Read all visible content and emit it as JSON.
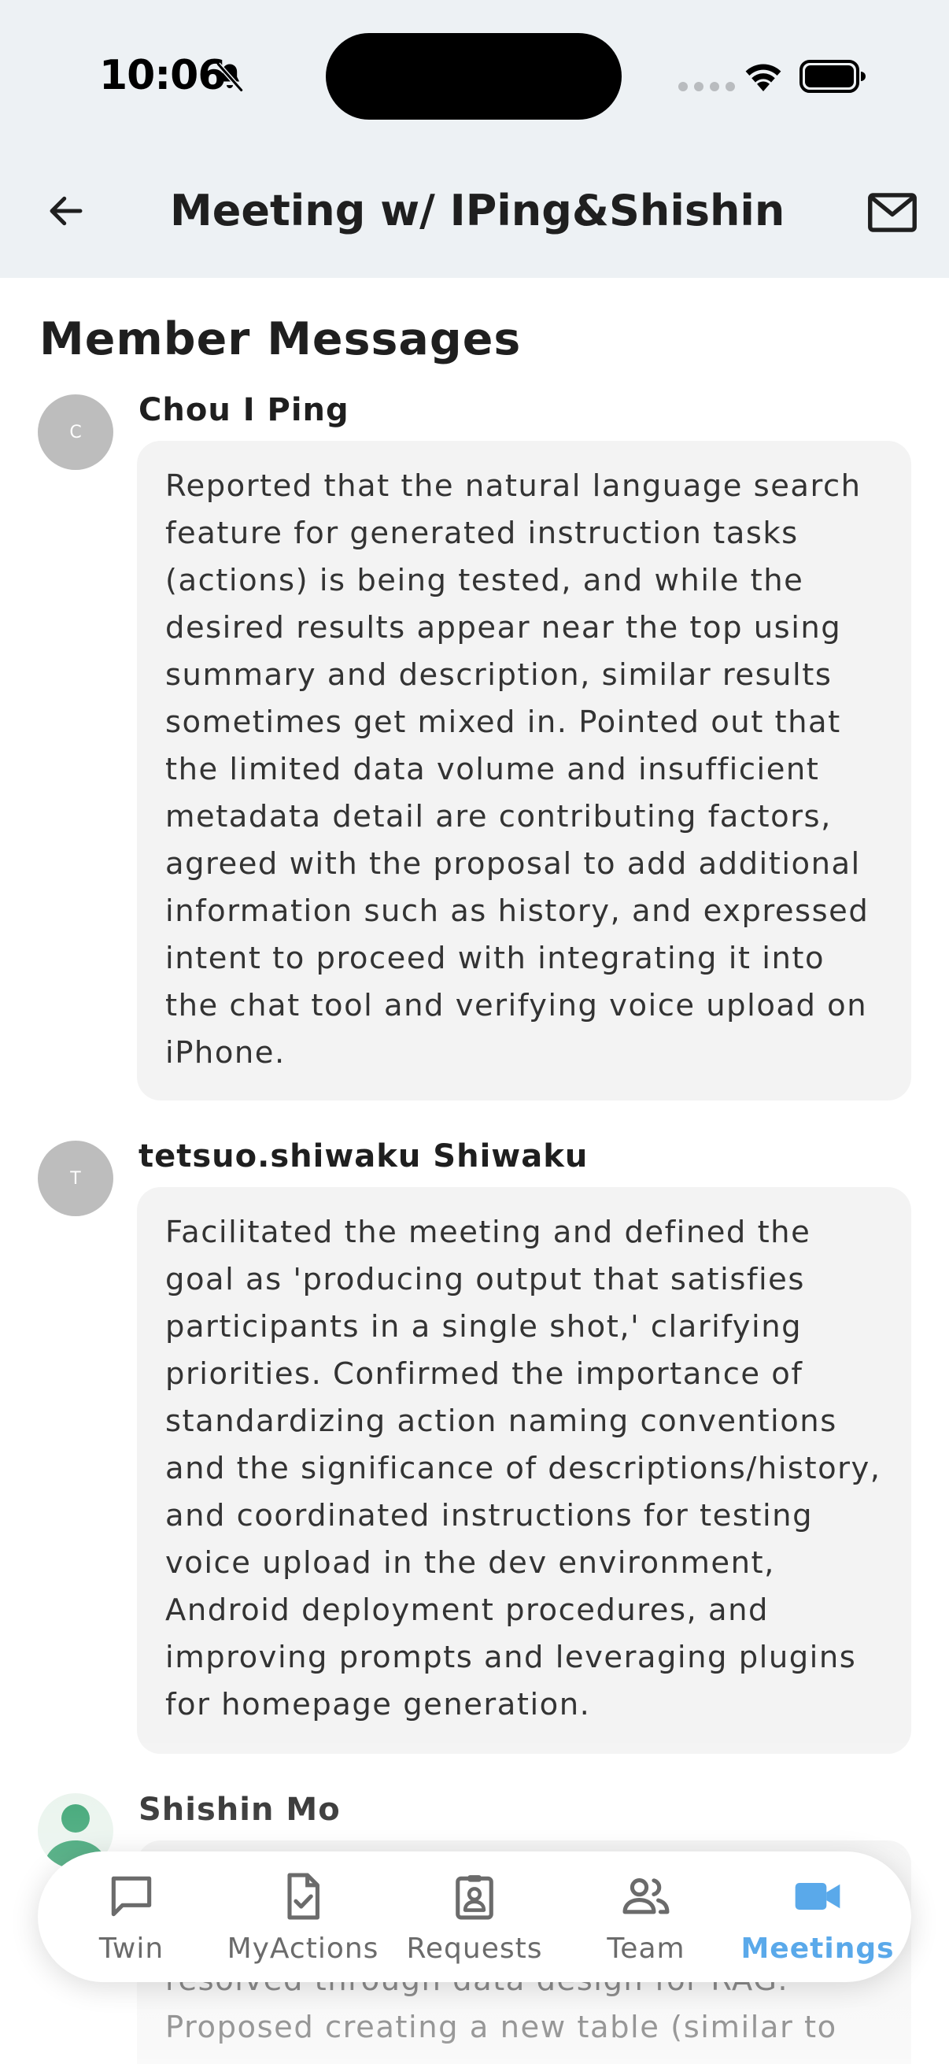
{
  "status_bar": {
    "time": "10:06"
  },
  "header": {
    "title": "Meeting w/ IPing&Shishin"
  },
  "section_title": "Member Messages",
  "messages": [
    {
      "initial": "C",
      "name": "Chou I Ping",
      "text": "Reported that the natural language search feature for generated instruction tasks (actions) is being tested, and while the desired results appear near the top using summary and description, similar results sometimes get mixed in. Pointed out that the limited data volume and insufficient metadata detail are contributing factors, agreed with the proposal to add additional information such as history, and expressed intent to proceed with integrating it into the chat tool and verifying voice upload on iPhone."
    },
    {
      "initial": "T",
      "name": "tetsuo.shiwaku Shiwaku",
      "text": "Facilitated the meeting and defined the goal as 'producing output that satisfies participants in a single shot,' clarifying priorities. Confirmed the importance of standardizing action naming conventions and the significance of descriptions/history, and coordinated instructions for testing voice upload in the dev environment, Android deployment procedures, and improving prompts and leveraging plugins for homepage generation."
    },
    {
      "initial": "",
      "name": "Shishin Mo",
      "text": "resolved through data design for RAG. Proposed creating a new table (similar to"
    }
  ],
  "nav": {
    "items": [
      {
        "label": "Twin",
        "icon": "chat-bubble-icon",
        "active": false
      },
      {
        "label": "MyActions",
        "icon": "task-check-icon",
        "active": false
      },
      {
        "label": "Requests",
        "icon": "clipboard-person-icon",
        "active": false
      },
      {
        "label": "Team",
        "icon": "people-icon",
        "active": false
      },
      {
        "label": "Meetings",
        "icon": "video-camera-icon",
        "active": true
      }
    ]
  },
  "colors": {
    "header_bg": "#edf1f4",
    "bubble_bg": "#f3f3f3",
    "avatar_gray": "#bdbdbd",
    "accent": "#5aa9ea",
    "person_green": "#2e9e6a"
  }
}
